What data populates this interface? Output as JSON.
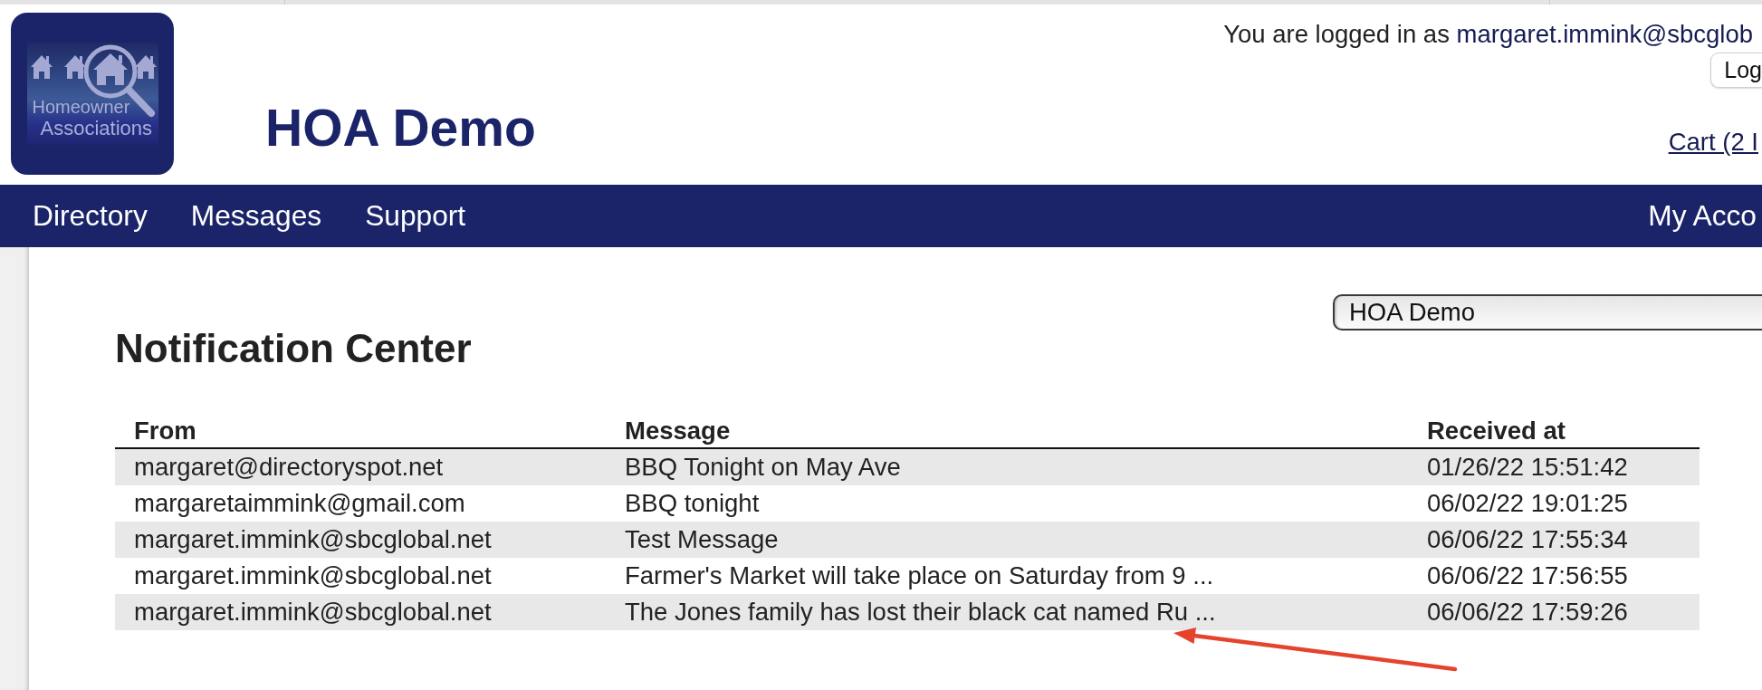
{
  "logo": {
    "lines": [
      "Homeowner",
      "Associations"
    ]
  },
  "site_title": "HOA Demo",
  "account": {
    "prefix": "You are logged in as",
    "email": "margaret.immink@sbcglob",
    "logout_button": "Log",
    "cart_link": "Cart (2 I"
  },
  "nav": {
    "items": [
      "Directory",
      "Messages",
      "Support"
    ],
    "right_items": [
      "My Acco"
    ]
  },
  "association_select": {
    "value": "HOA Demo"
  },
  "page_title": "Notification Center",
  "table": {
    "columns": [
      "From",
      "Message",
      "Received at"
    ],
    "rows": [
      [
        "margaret@directoryspot.net",
        "BBQ Tonight on May Ave",
        "01/26/22 15:51:42"
      ],
      [
        "margaretaimmink@gmail.com",
        "BBQ tonight",
        "06/02/22 19:01:25"
      ],
      [
        "margaret.immink@sbcglobal.net",
        "Test Message",
        "06/06/22 17:55:34"
      ],
      [
        "margaret.immink@sbcglobal.net",
        "Farmer's Market will take place on Saturday from 9 ...",
        "06/06/22 17:56:55"
      ],
      [
        "margaret.immink@sbcglobal.net",
        "The Jones family has lost their black cat named Ru ...",
        "06/06/22 17:59:26"
      ]
    ]
  }
}
